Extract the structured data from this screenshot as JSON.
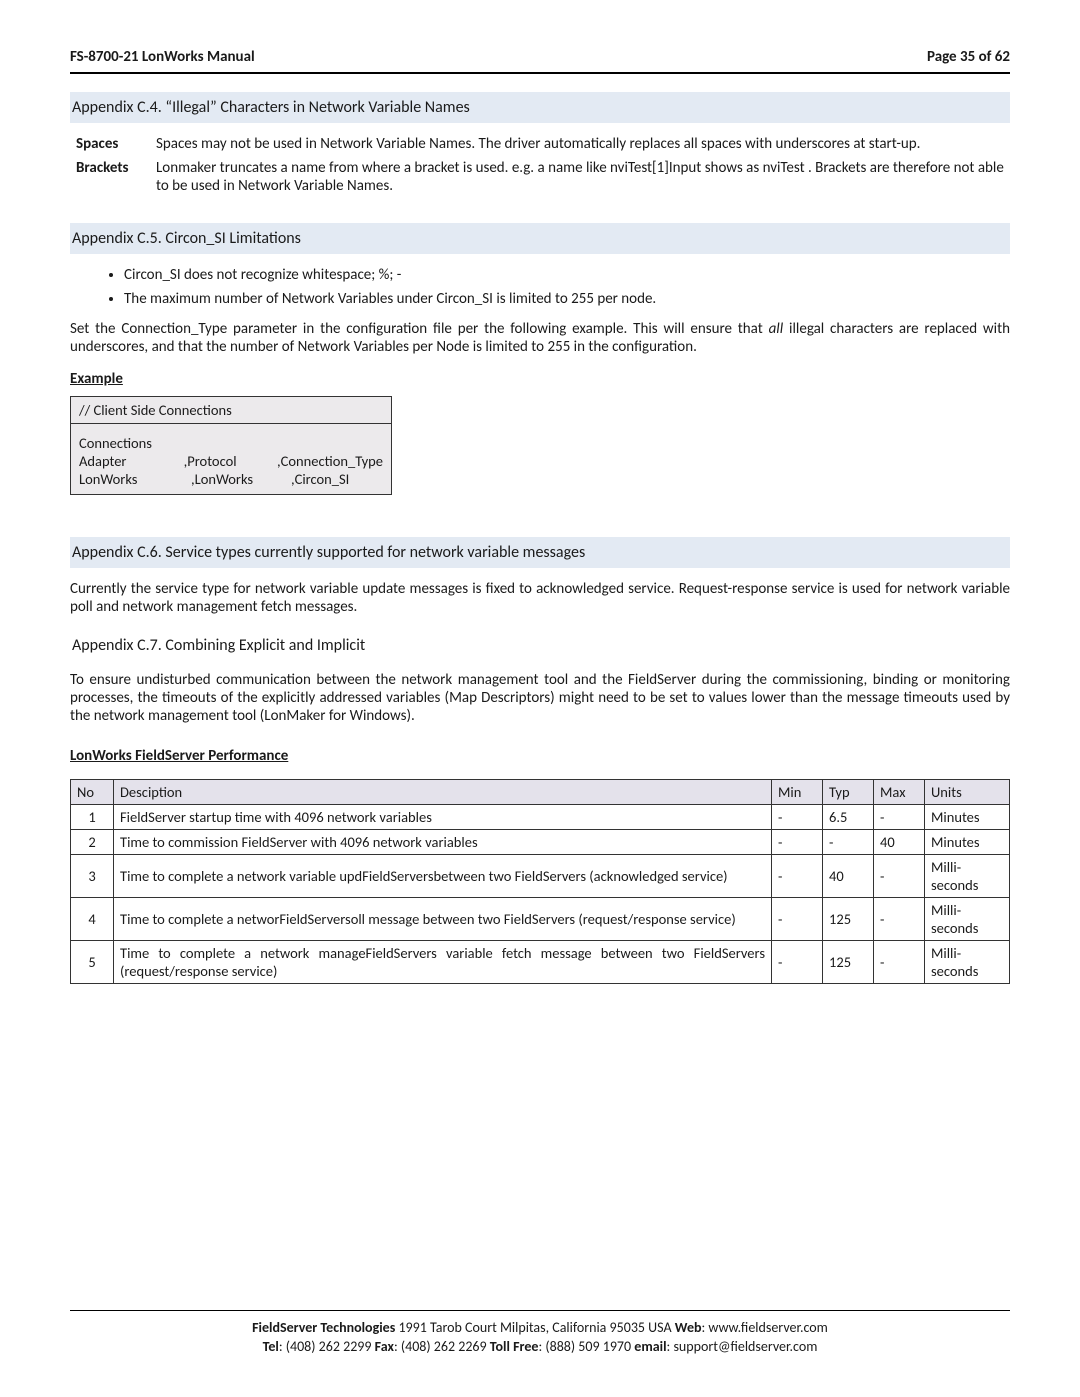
{
  "doc": {
    "header_left": "FS-8700-21 LonWorks Manual",
    "header_right": "Page 35 of 62"
  },
  "c4": {
    "title": "Appendix C.4. “Illegal” Characters in Network Variable Names",
    "spaces_term": "Spaces",
    "spaces_text": "Spaces may not be used in Network Variable Names.  The driver automatically replaces all spaces with underscores at start-up.",
    "brackets_term": "Brackets",
    "brackets_text": "Lonmaker truncates a name from where a bracket is used.  e.g. a name like nviTest[1]Input shows as nviTest .  Brackets are therefore not able to be used in Network Variable Names."
  },
  "c5": {
    "title": "Appendix C.5. Circon_SI Limitations",
    "bullet1": "Circon_SI does not recognize whitespace; %; -",
    "bullet2": "The maximum number of Network Variables under Circon_SI is limited to 255 per node.",
    "para_before": "Set the Connection_Type parameter in the configuration file per the following example.  This will ensure that ",
    "para_ital": "all",
    "para_after": " illegal characters are replaced with underscores, and that the number of Network Variables per Node is limited to 255 in the configuration.",
    "example_label": "Example",
    "code_r1": "//    Client Side Connections",
    "code_hdr": "Connections",
    "code_row1_c1": "Adapter",
    "code_row1_c2": ",Protocol",
    "code_row1_c3": ",Connection_Type",
    "code_row2_c1": "LonWorks",
    "code_row2_c2": ",LonWorks",
    "code_row2_c3": ",Circon_SI"
  },
  "c6": {
    "title": "Appendix C.6.  Service types currently supported for network variable messages",
    "para": "Currently the service type for network variable update messages is fixed to acknowledged service.  Request-response service is used for network variable poll and network management fetch messages."
  },
  "c7": {
    "title": "Appendix C.7. Combining Explicit and Implicit",
    "para": "To ensure undisturbed communication between the network management tool and the FieldServer during the commissioning, binding or monitoring processes, the timeouts of the explicitly addressed variables (Map Descriptors) might need to be set to values lower than the message timeouts used by the network management tool (LonMaker for Windows).",
    "perf_heading": "LonWorks FieldServer Performance",
    "th_no": "No",
    "th_desc": "Desciption",
    "th_min": "Min",
    "th_typ": "Typ",
    "th_max": "Max",
    "th_units": "Units",
    "rows": [
      {
        "no": "1",
        "desc": "FieldServer startup time with 4096 network variables",
        "min": "-",
        "typ": "6.5",
        "max": "-",
        "units": "Minutes"
      },
      {
        "no": "2",
        "desc": "Time to commission FieldServer with 4096 network variables",
        "min": "-",
        "typ": "-",
        "max": "40",
        "units": "Minutes"
      },
      {
        "no": "3",
        "desc": "Time to complete a network variable updFieldServersbetween two FieldServers (acknowledged service)",
        "min": "-",
        "typ": "40",
        "max": "-",
        "units": "Milli-seconds"
      },
      {
        "no": "4",
        "desc": "Time to complete a networFieldServersoll message between two FieldServers (request/response service)",
        "min": "-",
        "typ": "125",
        "max": "-",
        "units": "Milli-seconds"
      },
      {
        "no": "5",
        "desc": "Time to complete a network manageFieldServers variable fetch message between two FieldServers (request/response service)",
        "min": "-",
        "typ": "125",
        "max": "-",
        "units": "Milli-seconds"
      }
    ]
  },
  "footer": {
    "l1_b": "FieldServer Technologies",
    "l1_a": " 1991 Tarob Court Milpitas, California 95035 USA   ",
    "l1_wb": "Web",
    "l1_w": ": www.fieldserver.com",
    "l2_tb": "Tel",
    "l2_t": ": (408) 262 2299   ",
    "l2_fb": "Fax",
    "l2_f": ": (408) 262 2269   ",
    "l2_tfb": "Toll Free",
    "l2_tf": ": (888) 509 1970   ",
    "l2_eb": "email",
    "l2_e": ": support@fieldserver.com"
  }
}
